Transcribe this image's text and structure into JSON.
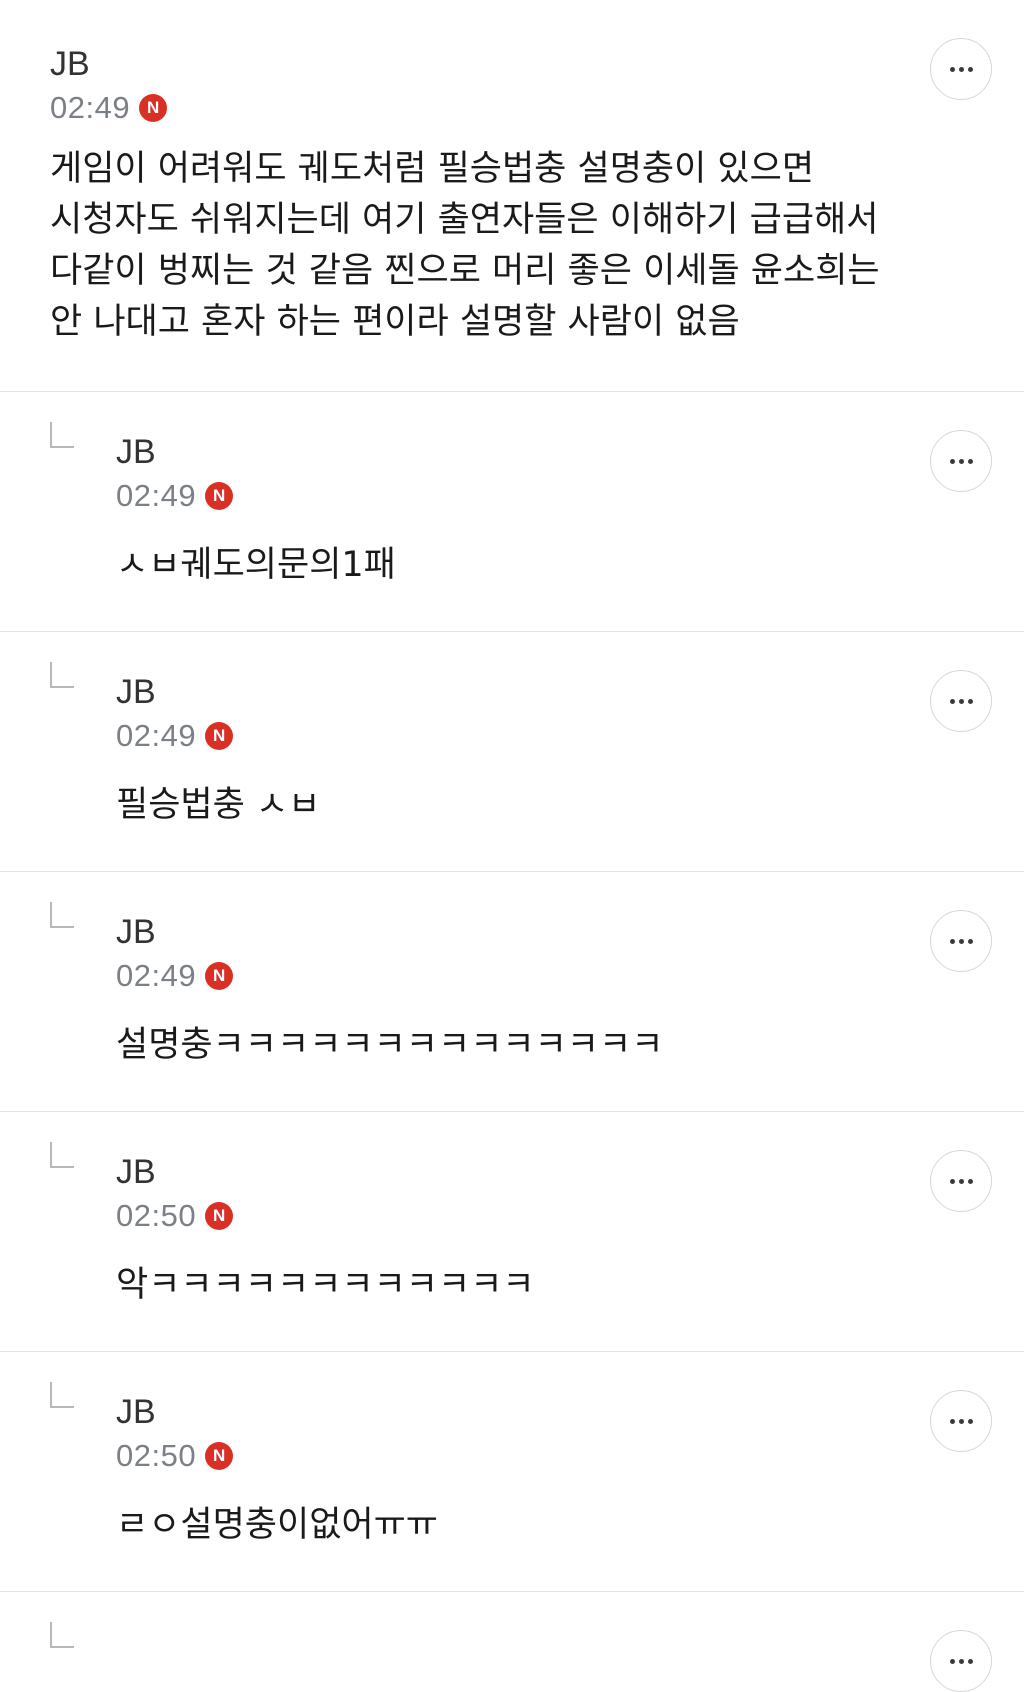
{
  "comments": [
    {
      "author": "JB",
      "time": "02:49",
      "badge": "N",
      "text": "게임이 어려워도 궤도처럼 필승법충 설명충이 있으면 시청자도 쉬워지는데 여기 출연자들은 이해하기 급급해서 다같이 벙찌는 것 같음 찐으로 머리 좋은 이세돌 윤소희는 안 나대고 혼자 하는 편이라 설명할 사람이 없음"
    },
    {
      "author": "JB",
      "time": "02:49",
      "badge": "N",
      "text": "ㅅㅂ궤도의문의1패"
    },
    {
      "author": "JB",
      "time": "02:49",
      "badge": "N",
      "text": "필승법충 ㅅㅂ"
    },
    {
      "author": "JB",
      "time": "02:49",
      "badge": "N",
      "text": "설명충ㅋㅋㅋㅋㅋㅋㅋㅋㅋㅋㅋㅋㅋㅋ"
    },
    {
      "author": "JB",
      "time": "02:50",
      "badge": "N",
      "text": "악ㅋㅋㅋㅋㅋㅋㅋㅋㅋㅋㅋㅋ"
    },
    {
      "author": "JB",
      "time": "02:50",
      "badge": "N",
      "text": "ㄹㅇ설명충이없어ㅠㅠ"
    }
  ],
  "icons": {
    "more": "more-options-icon",
    "reply": "reply-arrow-icon"
  },
  "colors": {
    "badge": "#d93025",
    "time": "#7b7f86",
    "divider": "#e3e3e3"
  }
}
